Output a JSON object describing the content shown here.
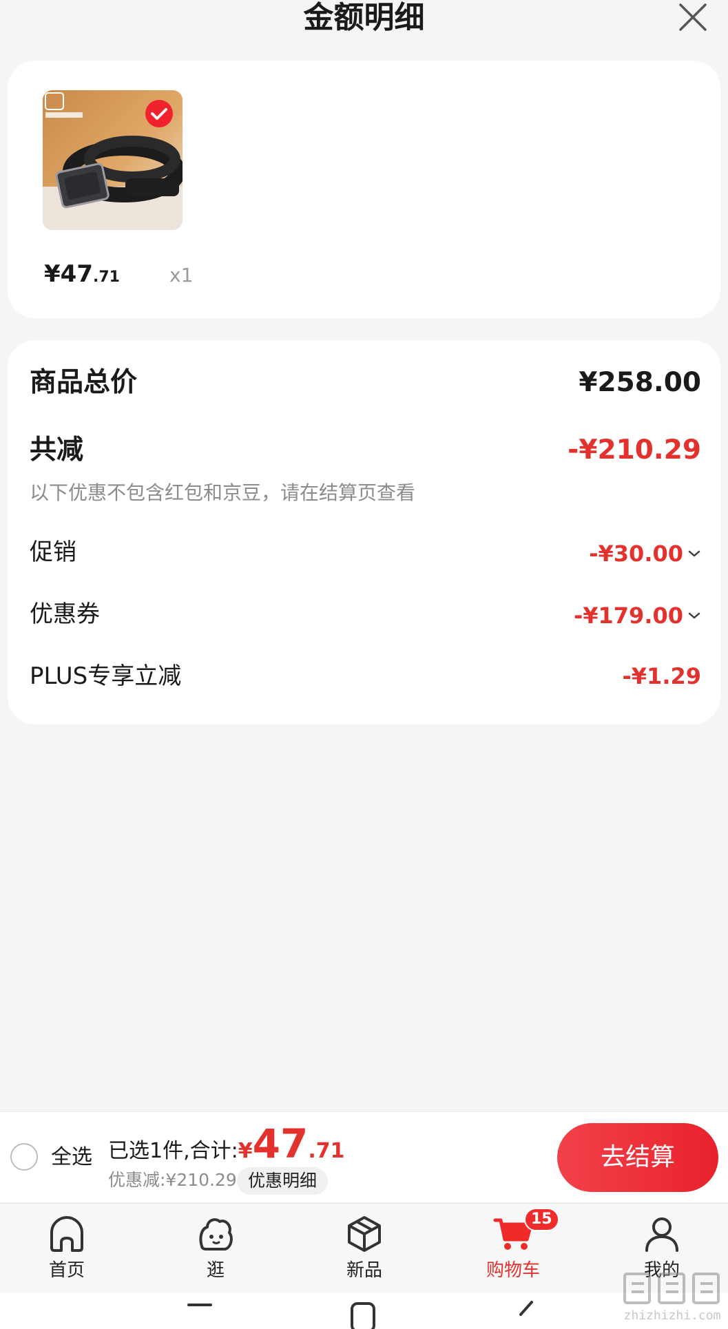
{
  "header": {
    "title": "金额明细",
    "close_icon": "close-icon"
  },
  "product": {
    "price_int": "¥47",
    "price_dec": ".71",
    "quantity": "x1",
    "selected": true,
    "thumbnail_brand": "SHERIDAN"
  },
  "details": {
    "total_label": "商品总价",
    "total_value": "¥258.00",
    "reduce_label": "共减",
    "reduce_value": "-¥210.29",
    "note": "以下优惠不包含红包和京豆，请在结算页查看",
    "items": [
      {
        "label": "促销",
        "value": "-¥30.00",
        "expandable": true
      },
      {
        "label": "优惠券",
        "value": "-¥179.00",
        "expandable": true
      },
      {
        "label": "PLUS专享立减",
        "value": "-¥1.29",
        "expandable": false
      }
    ]
  },
  "action_bar": {
    "select_all": "全选",
    "selected_text": "已选1件,合计:",
    "currency": "¥",
    "total_int": "47",
    "total_dec": ".71",
    "discount_text": "优惠减:¥210.29",
    "detail_button": "优惠明细",
    "checkout_button": "去结算"
  },
  "tabs": [
    {
      "label": "首页",
      "icon": "home-icon",
      "active": false
    },
    {
      "label": "逛",
      "icon": "explore-icon",
      "active": false
    },
    {
      "label": "新品",
      "icon": "new-products-icon",
      "active": false
    },
    {
      "label": "购物车",
      "icon": "cart-icon",
      "active": true,
      "badge": "15"
    },
    {
      "label": "我的",
      "icon": "profile-icon",
      "active": false
    }
  ],
  "watermark": "zhizhizhi.com",
  "colors": {
    "accent": "#e3312d",
    "background": "#f5f5f5",
    "card": "#ffffff"
  }
}
